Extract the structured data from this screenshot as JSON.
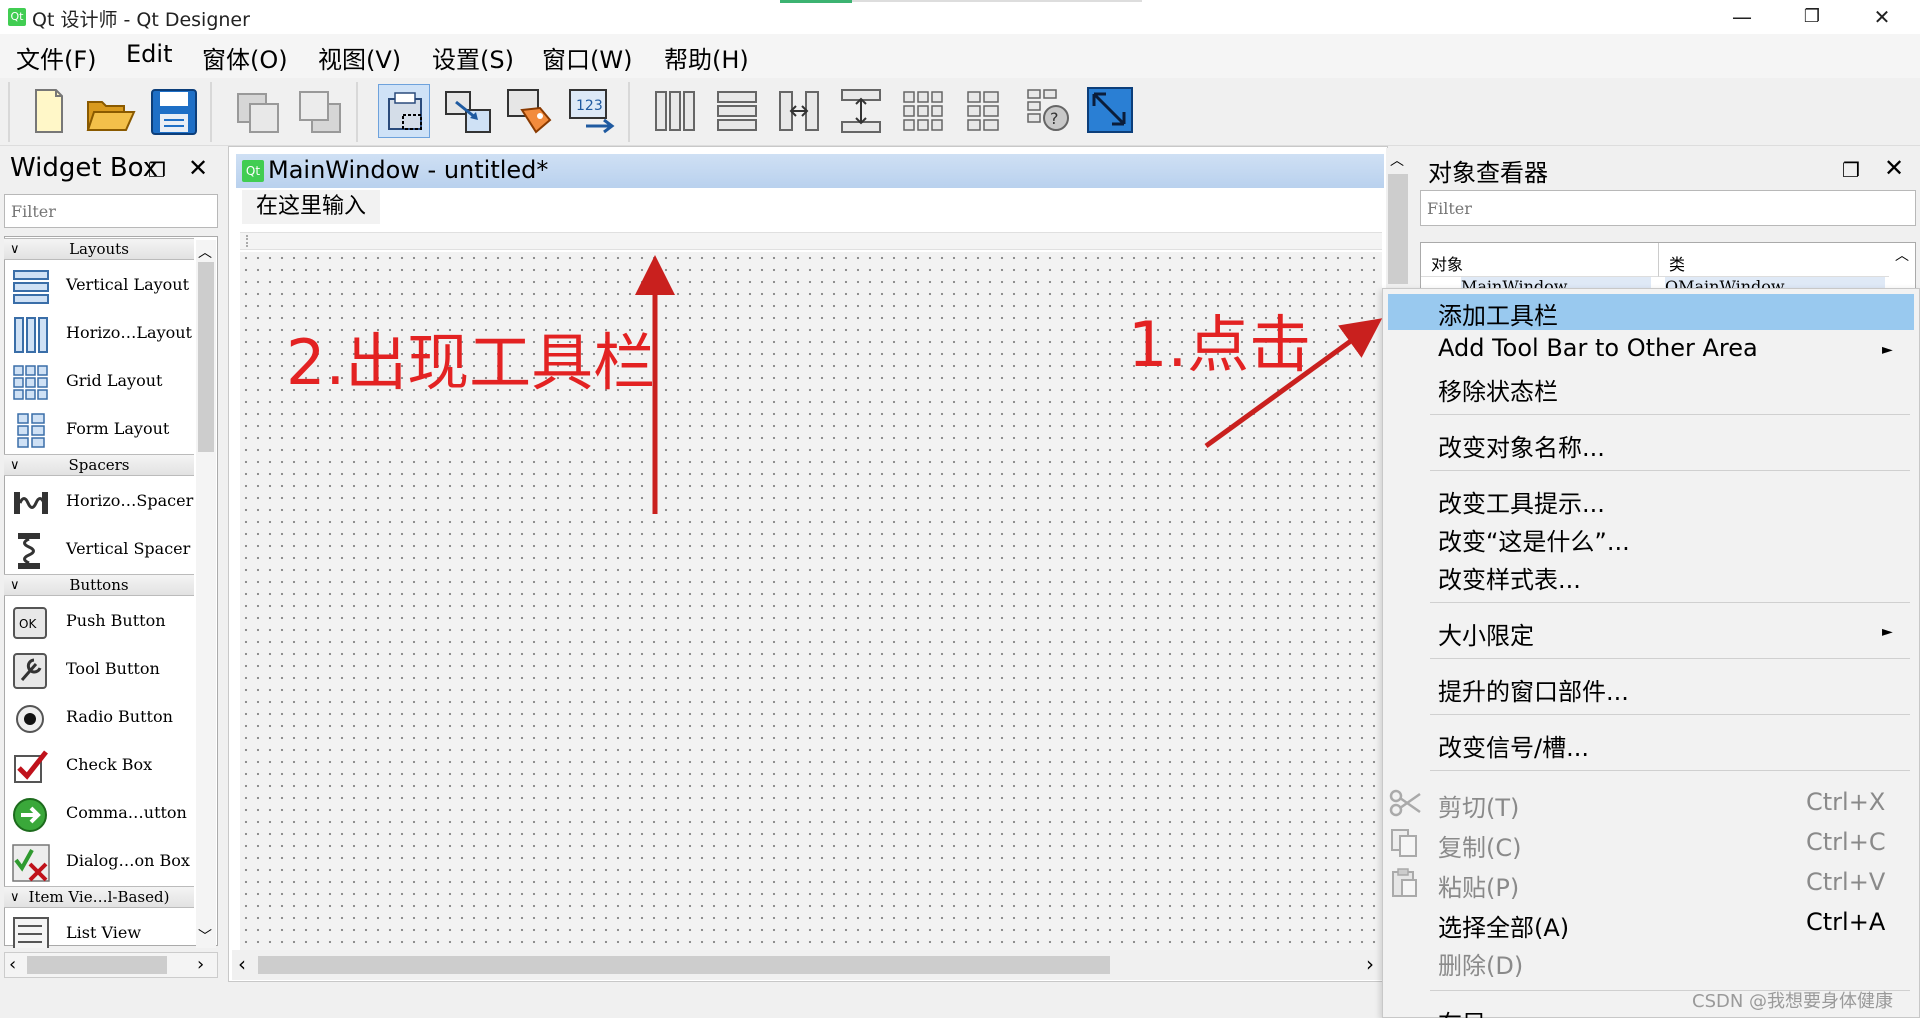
{
  "window": {
    "icon_text": "Qt",
    "title": "Qt 设计师 - Qt Designer",
    "controls": {
      "minimize": "—",
      "maximize": "❐",
      "close": "✕"
    }
  },
  "menu": [
    "文件(F)",
    "Edit",
    "窗体(O)",
    "视图(V)",
    "设置(S)",
    "窗口(W)",
    "帮助(H)"
  ],
  "toolbar": {
    "icons": [
      "new-file-icon",
      "open-file-icon",
      "save-file-icon",
      "send-to-back-icon",
      "bring-to-front-icon",
      "edit-widgets-icon",
      "edit-signals-slots-icon",
      "edit-buddies-icon",
      "edit-tab-order-icon",
      "layout-horizontal-icon",
      "layout-vertical-icon",
      "layout-horizontal-splitter-icon",
      "layout-vertical-splitter-icon",
      "layout-grid-icon",
      "layout-form-icon",
      "break-layout-icon",
      "adjust-size-icon"
    ]
  },
  "widget_box": {
    "title": "Widget Box",
    "filter_placeholder": "Filter",
    "categories": [
      {
        "label": "Layouts",
        "items": [
          "Vertical Layout",
          "Horizo…Layout",
          "Grid Layout",
          "Form Layout"
        ]
      },
      {
        "label": "Spacers",
        "items": [
          "Horizo…Spacer",
          "Vertical Spacer"
        ]
      },
      {
        "label": "Buttons",
        "items": [
          "Push Button",
          "Tool Button",
          "Radio Button",
          "Check Box",
          "Comma…utton",
          "Dialog…on Box"
        ]
      },
      {
        "label": "Item Vie…l-Based)",
        "items": [
          "List View"
        ]
      }
    ]
  },
  "form": {
    "icon_text": "Qt",
    "title": "MainWindow - untitled*",
    "menubar_placeholder": "在这里输入"
  },
  "object_inspector": {
    "title": "对象查看器",
    "filter_placeholder": "Filter",
    "columns": [
      "对象",
      "类"
    ],
    "row": [
      "MainWindow",
      "QMainWindow"
    ]
  },
  "context_menu": {
    "items": [
      {
        "label": "添加工具栏",
        "highlighted": true
      },
      {
        "label": "Add Tool Bar to Other Area",
        "submenu": true
      },
      {
        "label": "移除状态栏"
      },
      {
        "label": "改变对象名称..."
      },
      {
        "label": "改变工具提示..."
      },
      {
        "label": "改变“这是什么”..."
      },
      {
        "label": "改变样式表..."
      },
      {
        "label": "大小限定",
        "submenu": true
      },
      {
        "label": "提升的窗口部件..."
      },
      {
        "label": "改变信号/槽..."
      },
      {
        "label": "剪切(T)",
        "shortcut": "Ctrl+X",
        "disabled": true
      },
      {
        "label": "复制(C)",
        "shortcut": "Ctrl+C",
        "disabled": true
      },
      {
        "label": "粘贴(P)",
        "shortcut": "Ctrl+V",
        "disabled": true
      },
      {
        "label": "选择全部(A)",
        "shortcut": "Ctrl+A"
      },
      {
        "label": "删除(D)",
        "disabled": true
      },
      {
        "label": "布局"
      }
    ]
  },
  "annotations": {
    "step1": "1.点击",
    "step2": "2.出现工具栏",
    "color": "#e32222"
  },
  "watermark": "CSDN @我想要身体健康"
}
